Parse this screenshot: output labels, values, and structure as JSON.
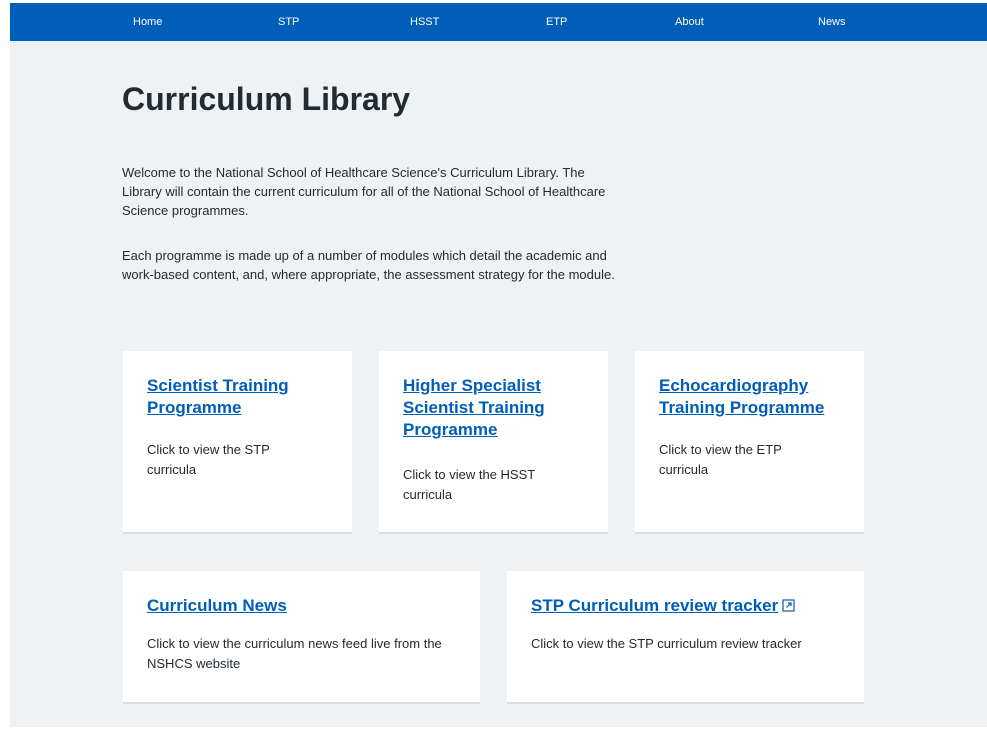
{
  "nav": {
    "items": [
      {
        "label": "Home"
      },
      {
        "label": "STP"
      },
      {
        "label": "HSST"
      },
      {
        "label": "ETP"
      },
      {
        "label": "About"
      },
      {
        "label": "News"
      }
    ]
  },
  "page": {
    "title": "Curriculum Library",
    "intro_paragraphs": [
      "Welcome to the National School of Healthcare Science's Curriculum Library. The Library will contain the current curriculum for all of the National School of Healthcare Science programmes.",
      "Each programme is made up of a number of modules which detail the academic and work-based content, and, where appropriate, the assessment strategy for the module."
    ]
  },
  "cards": [
    {
      "title": "Scientist Training Programme",
      "description": "Click to view the STP curricula"
    },
    {
      "title": "Higher Specialist Scientist Training Programme",
      "description": "Click to view the HSST curricula"
    },
    {
      "title": "Echocardiography Training Programme",
      "description": "Click to view the ETP curricula"
    },
    {
      "title": "Curriculum News",
      "description": "Click to view the curriculum news feed live from the NSHCS website"
    },
    {
      "title": "STP Curriculum review tracker",
      "description": "Click to view the STP curriculum review tracker",
      "icon": "external-link-icon"
    }
  ],
  "colors": {
    "nav_background": "#005eb8",
    "link": "#005eb8",
    "page_background": "#eef2f5",
    "text": "#212b32"
  }
}
